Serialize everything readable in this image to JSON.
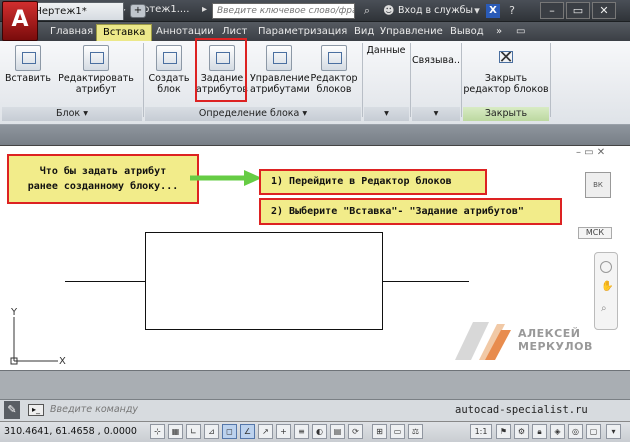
{
  "titlebar": {
    "doc_title": "Чертеж1....",
    "search_placeholder": "Введите ключевое слово/фразу",
    "login_label": "Вход в службы"
  },
  "menu_tabs": [
    "Главная",
    "Вставка",
    "Аннотации",
    "Лист",
    "Параметризация",
    "Вид",
    "Управление",
    "Вывод"
  ],
  "active_tab": "Вставка",
  "ribbon": {
    "buttons": [
      {
        "label": [
          "Вставить",
          ""
        ]
      },
      {
        "label": [
          "Редактировать",
          "атрибут"
        ]
      },
      {
        "label": [
          "Создать",
          "блок"
        ]
      },
      {
        "label": [
          "Задание",
          "атрибутов"
        ]
      },
      {
        "label": [
          "Управление",
          "атрибутами"
        ]
      },
      {
        "label": [
          "Редактор",
          "блоков"
        ]
      },
      {
        "label": [
          "Данные",
          ""
        ]
      },
      {
        "label": [
          "Связыва...",
          ""
        ]
      },
      {
        "label": [
          "Закрыть",
          "редактор блоков"
        ]
      }
    ],
    "groups": [
      "Блок ▾",
      "Определение блока ▾",
      "Закрыть"
    ]
  },
  "doc_tab": "Чертеж1*",
  "annotations": {
    "note1_line1": "Что бы задать атрибут",
    "note1_line2": "ранее созданному блоку...",
    "step1": "1) Перейдите в Редактор блоков",
    "step2": "2) Выберите \"Вставка\"- \"Задание атрибутов\""
  },
  "viewport": {
    "viewcube_label": "ВК",
    "ucs_label": "МСК",
    "axis_x": "X",
    "axis_y": "Y"
  },
  "watermark": {
    "line1": "АЛЕКСЕЙ",
    "line2": "МЕРКУЛОВ"
  },
  "command": {
    "placeholder": "Введите команду",
    "site": "autocad-specialist.ru"
  },
  "status": {
    "coords": "310.4641, 61.4658 , 0.0000"
  },
  "colors": {
    "accent_red": "#dd2222",
    "note_yellow": "#f2ec8a",
    "arrow_green": "#66cc44"
  }
}
